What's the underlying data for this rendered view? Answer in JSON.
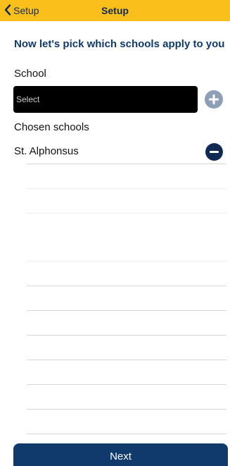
{
  "colors": {
    "nav_background": "#fbbf1c",
    "primary": "#0f3a6b",
    "add_button": "#8d9fb7",
    "select_background": "#000000"
  },
  "navbar": {
    "back_label": "Setup",
    "back_icon": "chevron-left-icon",
    "title": "Setup"
  },
  "main": {
    "heading": "Now let's pick which schools apply to you",
    "school_label": "School",
    "select_value": "Select",
    "add_icon": "plus-circle-icon",
    "chosen_label": "Chosen schools",
    "chosen_schools": [
      {
        "name": "St. Alphonsus",
        "remove_icon": "minus-circle-icon"
      }
    ]
  },
  "footer": {
    "next_label": "Next"
  }
}
